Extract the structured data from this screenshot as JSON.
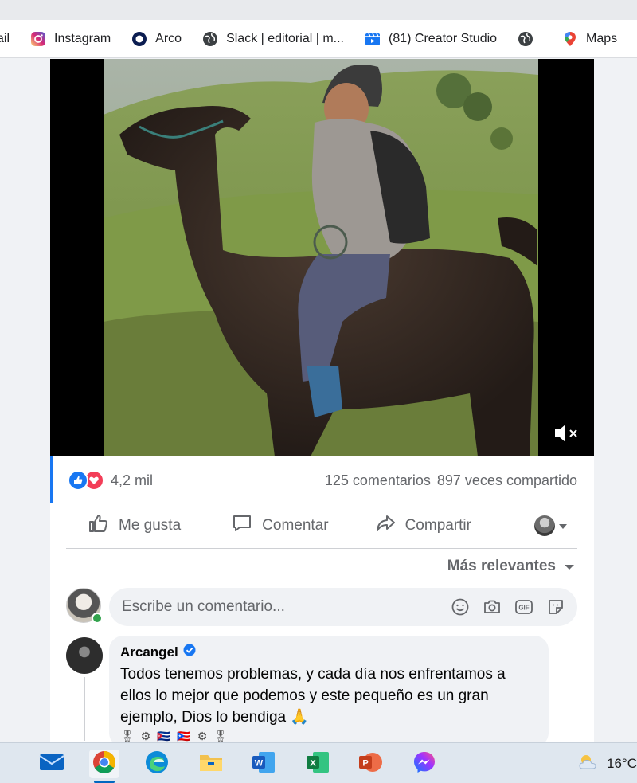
{
  "bookmarks": [
    {
      "label": "ail",
      "icon": "mail-icon"
    },
    {
      "label": "Instagram",
      "icon": "instagram-icon"
    },
    {
      "label": "Arco",
      "icon": "arco-icon"
    },
    {
      "label": "Slack | editorial | m...",
      "icon": "globe-icon"
    },
    {
      "label": "(81) Creator Studio",
      "icon": "creator-studio-icon"
    },
    {
      "label": "",
      "icon": "globe-icon"
    },
    {
      "label": "Maps",
      "icon": "maps-pin-icon"
    }
  ],
  "post": {
    "reactions": {
      "count": "4,2 mil"
    },
    "comments_count": "125 comentarios",
    "shares_count": "897 veces compartido",
    "actions": {
      "like": "Me gusta",
      "comment": "Comentar",
      "share": "Compartir"
    },
    "sort_label": "Más relevantes",
    "composer_placeholder": "Escribe un comentario...",
    "top_comment": {
      "author": "Arcangel",
      "text": "Todos tenemos problemas, y cada día nos enfrentamos a ellos lo mejor que podemos y este pequeño es un gran ejemplo, Dios lo bendiga 🙏",
      "flags": "🎖 ⚙ 🇨🇺 🇵🇷 ⚙ 🎖"
    }
  },
  "taskbar": {
    "apps": [
      "mail",
      "chrome",
      "edge",
      "file-explorer",
      "word",
      "excel",
      "powerpoint",
      "messenger"
    ],
    "temperature": "16°C"
  },
  "colors": {
    "facebook_blue": "#1877f2",
    "love_red": "#f33e58",
    "muted_text": "#65676b"
  }
}
